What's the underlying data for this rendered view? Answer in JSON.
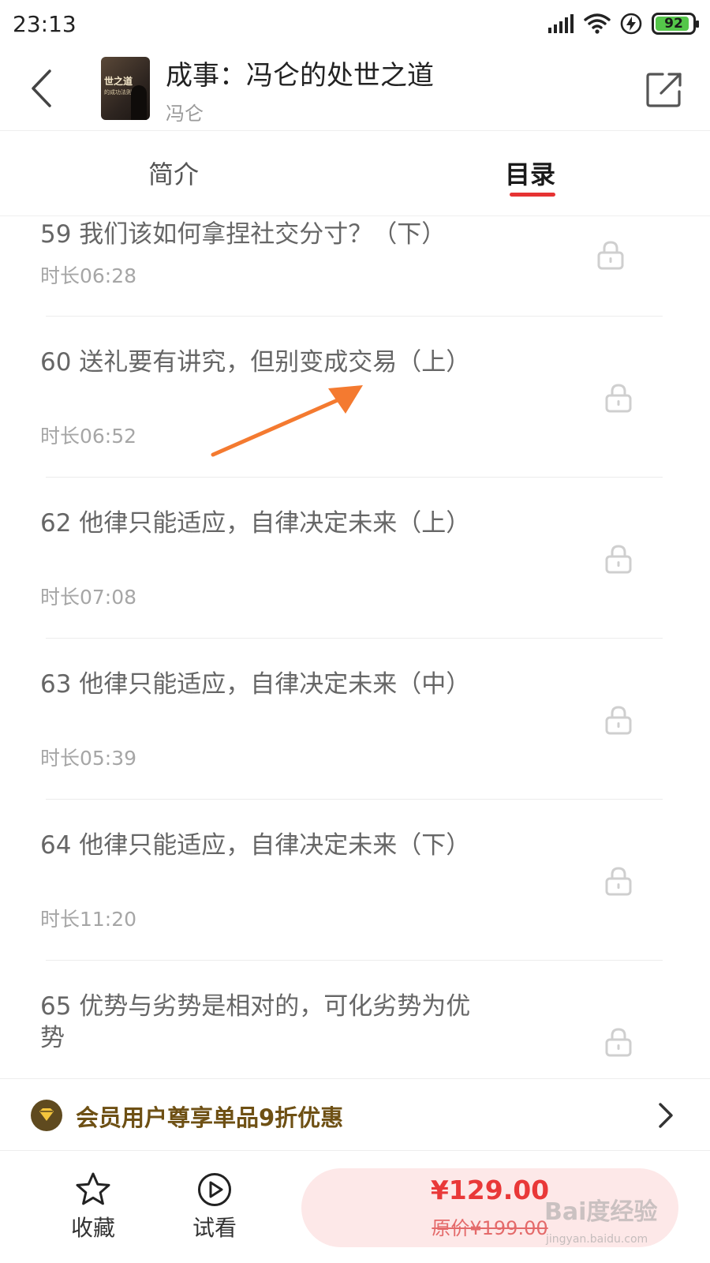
{
  "status_bar": {
    "time": "23:13",
    "battery": "92",
    "battery_level": 0.92
  },
  "header": {
    "back_icon": "chevron-left-icon",
    "cover_title": "世之道",
    "cover_subtitle": "的成功法则",
    "book_title": "成事：冯仑的处世之道",
    "author": "冯仑",
    "share_icon": "share-icon"
  },
  "tabs": [
    {
      "label": "简介",
      "active": false
    },
    {
      "label": "目录",
      "active": true
    }
  ],
  "accent_color": "#e63333",
  "episodes": [
    {
      "title": "59 我们该如何拿捏社交分寸？（下）",
      "duration": "时长06:28",
      "locked": true
    },
    {
      "title": "60 送礼要有讲究，但别变成交易（上）",
      "duration": "时长06:52",
      "locked": true
    },
    {
      "title": "62 他律只能适应，自律决定未来（上）",
      "duration": "时长07:08",
      "locked": true
    },
    {
      "title": "63 他律只能适应，自律决定未来（中）",
      "duration": "时长05:39",
      "locked": true
    },
    {
      "title": "64 他律只能适应，自律决定未来（下）",
      "duration": "时长11:20",
      "locked": true
    },
    {
      "title": "65 优势与劣势是相对的，可化劣势为优势",
      "duration": "",
      "locked": true
    }
  ],
  "member_banner": {
    "text": "会员用户尊享单品9折优惠",
    "icon": "vip-diamond-icon"
  },
  "bottom_bar": {
    "favorite_label": "收藏",
    "trial_label": "试看",
    "price": "¥129.00",
    "original_price": "原价¥199.00"
  },
  "watermark": {
    "logo": "Bai度经验",
    "url": "jingyan.baidu.com"
  }
}
